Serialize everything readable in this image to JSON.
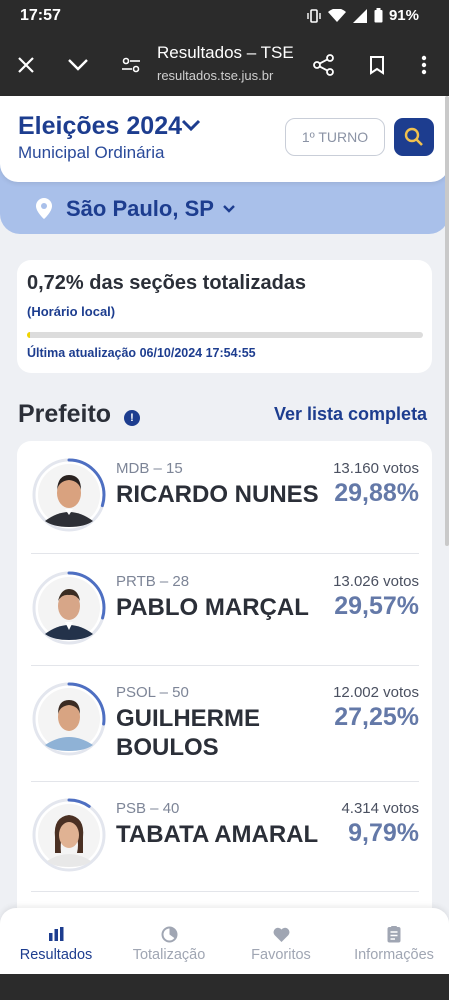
{
  "status_bar": {
    "time": "17:57",
    "battery_pct": "91%",
    "icons": [
      "vibrate-icon",
      "wifi-icon",
      "signal-icon",
      "battery-icon"
    ]
  },
  "browser": {
    "title": "Resultados – TSE",
    "url": "resultados.tse.jus.br",
    "buttons": [
      "close-icon",
      "chevron-down-icon",
      "site-settings-icon",
      "share-icon",
      "bookmark-icon",
      "more-vert-icon"
    ]
  },
  "header": {
    "title": "Eleições 2024",
    "subtitle": "Municipal Ordinária",
    "turno_label": "1º TURNO",
    "search_icon": "search-icon"
  },
  "location": {
    "name": "São Paulo, SP",
    "icon": "location-pin-icon"
  },
  "progress": {
    "title": "0,72% das seções totalizadas",
    "subtitle": "(Horário local)",
    "fraction": 0.0072,
    "last_update_label": "Última atualização",
    "last_update": "06/10/2024 17:54:55",
    "bar_color": "#f0d400"
  },
  "section": {
    "title": "Prefeito",
    "info_icon": "info-icon",
    "link": "Ver lista completa"
  },
  "candidates": [
    {
      "party": "MDB – 15",
      "name": "RICARDO NUNES",
      "votes": "13.160 votos",
      "percent": "29,88%",
      "share": 0.2988
    },
    {
      "party": "PRTB – 28",
      "name": "PABLO MARÇAL",
      "votes": "13.026 votos",
      "percent": "29,57%",
      "share": 0.2957
    },
    {
      "party": "PSOL – 50",
      "name": "GUILHERME BOULOS",
      "votes": "12.002 votos",
      "percent": "27,25%",
      "share": 0.2725
    },
    {
      "party": "PSB – 40",
      "name": "TABATA AMARAL",
      "votes": "4.314 votos",
      "percent": "9,79%",
      "share": 0.0979
    }
  ],
  "bottom_nav": [
    {
      "label": "Resultados",
      "icon": "bar-chart-icon",
      "active": true
    },
    {
      "label": "Totalização",
      "icon": "pie-chart-icon",
      "active": false
    },
    {
      "label": "Favoritos",
      "icon": "heart-icon",
      "active": false
    },
    {
      "label": "Informações",
      "icon": "document-icon",
      "active": false
    }
  ],
  "colors": {
    "brand": "#1d3d8f",
    "location_band": "#a9c0ea",
    "percent_text": "#6479a8",
    "ring": "#4e6fc2"
  }
}
